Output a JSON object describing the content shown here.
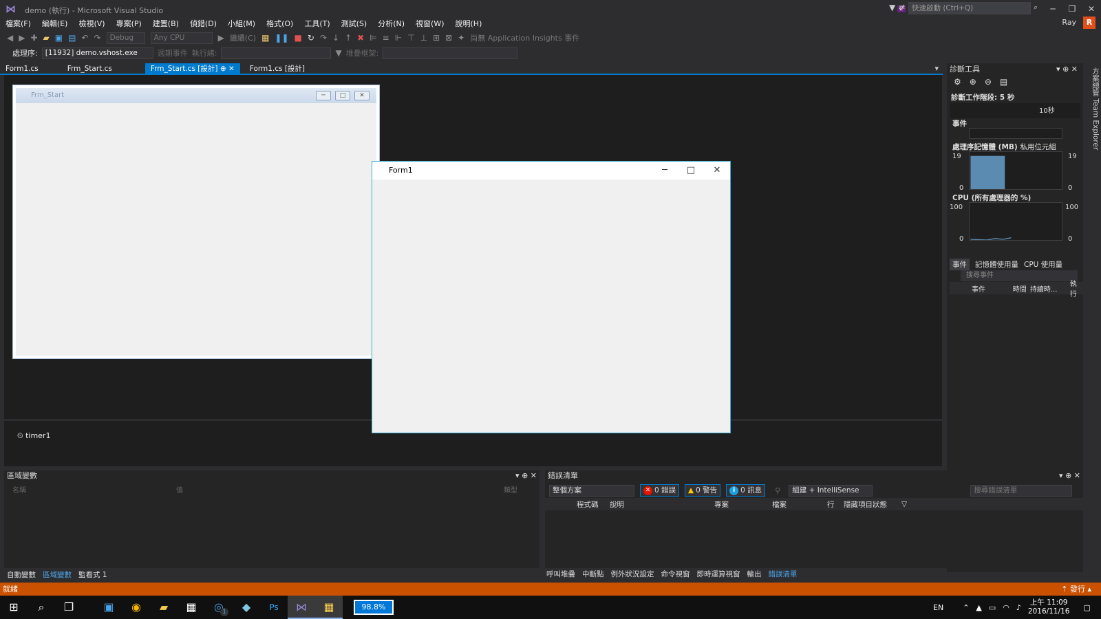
{
  "title": "demo (執行) - Microsoft Visual Studio",
  "quick_launch": "快速啟動 (Ctrl+Q)",
  "notif_count": "2",
  "user": "Ray",
  "user_initial": "R",
  "menus": [
    "檔案(F)",
    "編輯(E)",
    "檢視(V)",
    "專案(P)",
    "建置(B)",
    "偵錯(D)",
    "小組(M)",
    "格式(O)",
    "工具(T)",
    "測試(S)",
    "分析(N)",
    "視窗(W)",
    "說明(H)"
  ],
  "toolbar": {
    "config": "Debug",
    "platform": "Any CPU",
    "continue": "繼續(C)",
    "insights": "尚無 Application Insights 事件"
  },
  "toolbar2": {
    "process_label": "處理序:",
    "process": "[11932] demo.vshost.exe",
    "lifecycle": "週期事件",
    "thread_label": "執行緒:",
    "stack_label": "堆疊框架:"
  },
  "tabs": [
    "Form1.cs",
    "Frm_Start.cs",
    "Frm_Start.cs [設計]",
    "Form1.cs [設計]"
  ],
  "designer": {
    "frm_start_title": "Frm_Start",
    "timer": "timer1"
  },
  "form1": {
    "title": "Form1"
  },
  "diag": {
    "title": "診斷工具",
    "session": "診斷工作階段: 5 秒",
    "tick": "10秒",
    "events": "事件",
    "memory": "處理序記憶體 (MB)",
    "private": "私用位元組",
    "mem_top": "19",
    "mem_bottom": "0",
    "cpu": "CPU (所有處理器的 %)",
    "cpu_top": "100",
    "cpu_bottom": "0",
    "tabs": [
      "事件",
      "記憶體使用量",
      "CPU 使用量"
    ],
    "search": "搜尋事件",
    "cols": [
      "事件",
      "時間",
      "持續時...",
      "執行"
    ]
  },
  "chart_data": [
    {
      "type": "area",
      "title": "處理序記憶體 (MB)",
      "ylim": [
        0,
        19
      ],
      "series": [
        {
          "name": "私用位元組",
          "x": [
            0,
            5
          ],
          "values": [
            17,
            17
          ]
        }
      ]
    },
    {
      "type": "area",
      "title": "CPU (所有處理器的 %)",
      "ylim": [
        0,
        100
      ],
      "series": [
        {
          "name": "",
          "x": [
            0,
            1,
            2,
            3,
            4,
            5
          ],
          "values": [
            2,
            1,
            0,
            4,
            2,
            6
          ]
        }
      ]
    }
  ],
  "locals": {
    "title": "區域變數",
    "cols": [
      "名稱",
      "值",
      "類型"
    ],
    "tabs": [
      "自動變數",
      "區域變數",
      "監看式 1"
    ]
  },
  "errlist": {
    "title": "錯誤清單",
    "scope": "整個方案",
    "errors": "0 錯誤",
    "warnings": "0 警告",
    "messages": "0 訊息",
    "build": "組建 + IntelliSense",
    "search": "搜尋錯誤清單",
    "cols": [
      "程式碼",
      "說明",
      "專案",
      "檔案",
      "行",
      "隱藏項目狀態"
    ],
    "tabs": [
      "呼叫堆疊",
      "中斷點",
      "例外狀況設定",
      "命令視窗",
      "即時運算視窗",
      "輸出",
      "錯誤清單"
    ]
  },
  "right_tabs": "方案總管 Team Explorer",
  "status": {
    "text": "就緒",
    "publish": "發行"
  },
  "taskbar": {
    "battery": "98.8%",
    "lang": "EN",
    "time": "上午 11:09",
    "date": "2016/11/16",
    "badge": "1"
  },
  "colors": {
    "accent": "#007acc",
    "status": "#ca5100",
    "memory_fill": "#5b8bb0"
  }
}
